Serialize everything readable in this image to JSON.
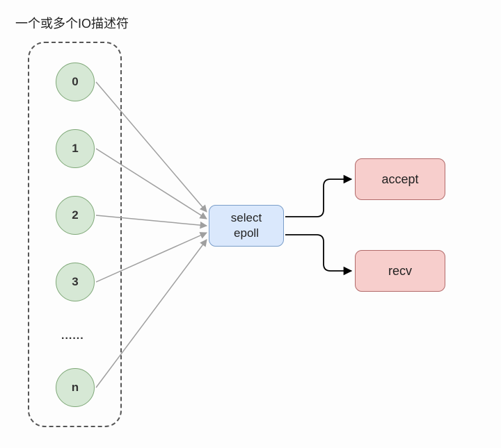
{
  "title": "一个或多个IO描述符",
  "fds": {
    "fd0": "0",
    "fd1": "1",
    "fd2": "2",
    "fd3": "3",
    "dots": "......",
    "fdn": "n"
  },
  "selector": {
    "line1": "select",
    "line2": "epoll"
  },
  "outputs": {
    "accept": "accept",
    "recv": "recv"
  },
  "colors": {
    "circleFill": "#d6e8d5",
    "circleStroke": "#7fa878",
    "selectFill": "#dae8fc",
    "selectStroke": "#7a9dc9",
    "resultFill": "#f7cecc",
    "resultStroke": "#b26a6a",
    "grayArrow": "#9f9f9f",
    "blackArrow": "#000000"
  },
  "chart_data": {
    "type": "diagram",
    "title": "一个或多个IO描述符",
    "nodes": [
      {
        "id": "fd0",
        "label": "0",
        "type": "io-descriptor"
      },
      {
        "id": "fd1",
        "label": "1",
        "type": "io-descriptor"
      },
      {
        "id": "fd2",
        "label": "2",
        "type": "io-descriptor"
      },
      {
        "id": "fd3",
        "label": "3",
        "type": "io-descriptor"
      },
      {
        "id": "fdn",
        "label": "n",
        "type": "io-descriptor"
      },
      {
        "id": "selector",
        "label": "select epoll",
        "type": "multiplexer"
      },
      {
        "id": "accept",
        "label": "accept",
        "type": "handler"
      },
      {
        "id": "recv",
        "label": "recv",
        "type": "handler"
      }
    ],
    "edges": [
      {
        "from": "fd0",
        "to": "selector"
      },
      {
        "from": "fd1",
        "to": "selector"
      },
      {
        "from": "fd2",
        "to": "selector"
      },
      {
        "from": "fd3",
        "to": "selector"
      },
      {
        "from": "fdn",
        "to": "selector"
      },
      {
        "from": "selector",
        "to": "accept"
      },
      {
        "from": "selector",
        "to": "recv"
      }
    ]
  }
}
